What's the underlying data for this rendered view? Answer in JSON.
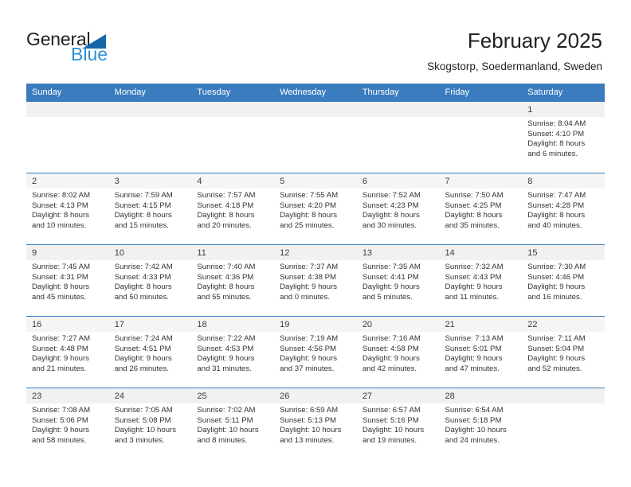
{
  "brand": {
    "name_part1": "General",
    "name_part2": "Blue",
    "triangle_color": "#1565a8",
    "blue_color": "#2e8fd6"
  },
  "header": {
    "title": "February 2025",
    "subtitle": "Skogstorp, Soedermanland, Sweden"
  },
  "theme": {
    "header_bar": "#3a7cbe",
    "daynum_band": "#f1f1f1",
    "text": "#333333"
  },
  "weekdays": [
    "Sunday",
    "Monday",
    "Tuesday",
    "Wednesday",
    "Thursday",
    "Friday",
    "Saturday"
  ],
  "weeks": [
    [
      {
        "day": "",
        "lines": []
      },
      {
        "day": "",
        "lines": []
      },
      {
        "day": "",
        "lines": []
      },
      {
        "day": "",
        "lines": []
      },
      {
        "day": "",
        "lines": []
      },
      {
        "day": "",
        "lines": []
      },
      {
        "day": "1",
        "lines": [
          "Sunrise: 8:04 AM",
          "Sunset: 4:10 PM",
          "Daylight: 8 hours",
          "and 6 minutes."
        ]
      }
    ],
    [
      {
        "day": "2",
        "lines": [
          "Sunrise: 8:02 AM",
          "Sunset: 4:13 PM",
          "Daylight: 8 hours",
          "and 10 minutes."
        ]
      },
      {
        "day": "3",
        "lines": [
          "Sunrise: 7:59 AM",
          "Sunset: 4:15 PM",
          "Daylight: 8 hours",
          "and 15 minutes."
        ]
      },
      {
        "day": "4",
        "lines": [
          "Sunrise: 7:57 AM",
          "Sunset: 4:18 PM",
          "Daylight: 8 hours",
          "and 20 minutes."
        ]
      },
      {
        "day": "5",
        "lines": [
          "Sunrise: 7:55 AM",
          "Sunset: 4:20 PM",
          "Daylight: 8 hours",
          "and 25 minutes."
        ]
      },
      {
        "day": "6",
        "lines": [
          "Sunrise: 7:52 AM",
          "Sunset: 4:23 PM",
          "Daylight: 8 hours",
          "and 30 minutes."
        ]
      },
      {
        "day": "7",
        "lines": [
          "Sunrise: 7:50 AM",
          "Sunset: 4:25 PM",
          "Daylight: 8 hours",
          "and 35 minutes."
        ]
      },
      {
        "day": "8",
        "lines": [
          "Sunrise: 7:47 AM",
          "Sunset: 4:28 PM",
          "Daylight: 8 hours",
          "and 40 minutes."
        ]
      }
    ],
    [
      {
        "day": "9",
        "lines": [
          "Sunrise: 7:45 AM",
          "Sunset: 4:31 PM",
          "Daylight: 8 hours",
          "and 45 minutes."
        ]
      },
      {
        "day": "10",
        "lines": [
          "Sunrise: 7:42 AM",
          "Sunset: 4:33 PM",
          "Daylight: 8 hours",
          "and 50 minutes."
        ]
      },
      {
        "day": "11",
        "lines": [
          "Sunrise: 7:40 AM",
          "Sunset: 4:36 PM",
          "Daylight: 8 hours",
          "and 55 minutes."
        ]
      },
      {
        "day": "12",
        "lines": [
          "Sunrise: 7:37 AM",
          "Sunset: 4:38 PM",
          "Daylight: 9 hours",
          "and 0 minutes."
        ]
      },
      {
        "day": "13",
        "lines": [
          "Sunrise: 7:35 AM",
          "Sunset: 4:41 PM",
          "Daylight: 9 hours",
          "and 5 minutes."
        ]
      },
      {
        "day": "14",
        "lines": [
          "Sunrise: 7:32 AM",
          "Sunset: 4:43 PM",
          "Daylight: 9 hours",
          "and 11 minutes."
        ]
      },
      {
        "day": "15",
        "lines": [
          "Sunrise: 7:30 AM",
          "Sunset: 4:46 PM",
          "Daylight: 9 hours",
          "and 16 minutes."
        ]
      }
    ],
    [
      {
        "day": "16",
        "lines": [
          "Sunrise: 7:27 AM",
          "Sunset: 4:48 PM",
          "Daylight: 9 hours",
          "and 21 minutes."
        ]
      },
      {
        "day": "17",
        "lines": [
          "Sunrise: 7:24 AM",
          "Sunset: 4:51 PM",
          "Daylight: 9 hours",
          "and 26 minutes."
        ]
      },
      {
        "day": "18",
        "lines": [
          "Sunrise: 7:22 AM",
          "Sunset: 4:53 PM",
          "Daylight: 9 hours",
          "and 31 minutes."
        ]
      },
      {
        "day": "19",
        "lines": [
          "Sunrise: 7:19 AM",
          "Sunset: 4:56 PM",
          "Daylight: 9 hours",
          "and 37 minutes."
        ]
      },
      {
        "day": "20",
        "lines": [
          "Sunrise: 7:16 AM",
          "Sunset: 4:58 PM",
          "Daylight: 9 hours",
          "and 42 minutes."
        ]
      },
      {
        "day": "21",
        "lines": [
          "Sunrise: 7:13 AM",
          "Sunset: 5:01 PM",
          "Daylight: 9 hours",
          "and 47 minutes."
        ]
      },
      {
        "day": "22",
        "lines": [
          "Sunrise: 7:11 AM",
          "Sunset: 5:04 PM",
          "Daylight: 9 hours",
          "and 52 minutes."
        ]
      }
    ],
    [
      {
        "day": "23",
        "lines": [
          "Sunrise: 7:08 AM",
          "Sunset: 5:06 PM",
          "Daylight: 9 hours",
          "and 58 minutes."
        ]
      },
      {
        "day": "24",
        "lines": [
          "Sunrise: 7:05 AM",
          "Sunset: 5:08 PM",
          "Daylight: 10 hours",
          "and 3 minutes."
        ]
      },
      {
        "day": "25",
        "lines": [
          "Sunrise: 7:02 AM",
          "Sunset: 5:11 PM",
          "Daylight: 10 hours",
          "and 8 minutes."
        ]
      },
      {
        "day": "26",
        "lines": [
          "Sunrise: 6:59 AM",
          "Sunset: 5:13 PM",
          "Daylight: 10 hours",
          "and 13 minutes."
        ]
      },
      {
        "day": "27",
        "lines": [
          "Sunrise: 6:57 AM",
          "Sunset: 5:16 PM",
          "Daylight: 10 hours",
          "and 19 minutes."
        ]
      },
      {
        "day": "28",
        "lines": [
          "Sunrise: 6:54 AM",
          "Sunset: 5:18 PM",
          "Daylight: 10 hours",
          "and 24 minutes."
        ]
      },
      {
        "day": "",
        "lines": []
      }
    ]
  ]
}
